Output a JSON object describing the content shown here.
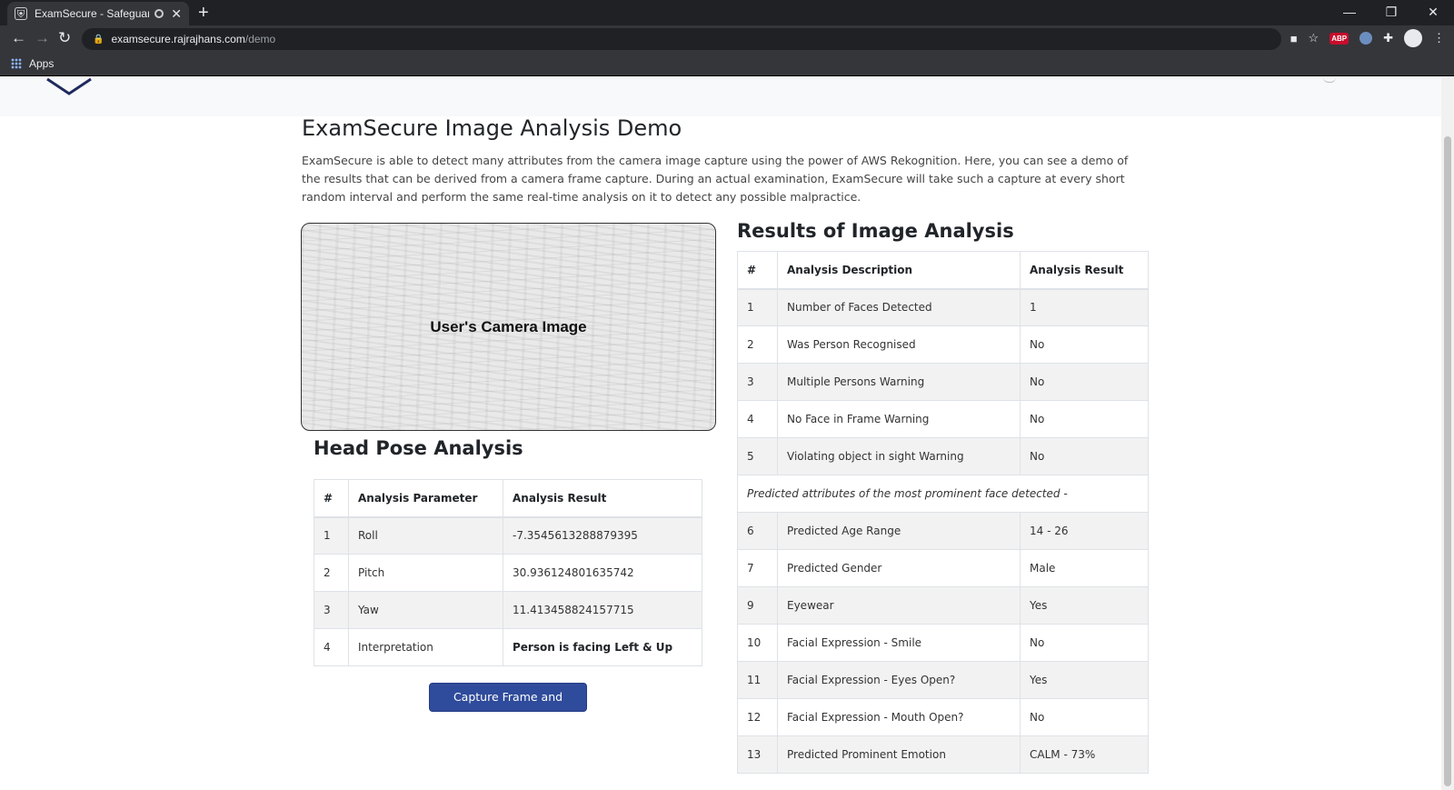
{
  "browser": {
    "tab_title": "ExamSecure - Safeguard you",
    "url_domain": "examsecure.rajrajhans.com",
    "url_path": "/demo",
    "bookmarks_apps": "Apps",
    "abp_label": "ABP",
    "window_controls": [
      "—",
      "❐",
      "✕"
    ]
  },
  "page": {
    "title": "ExamSecure Image Analysis Demo",
    "intro": "ExamSecure is able to detect many attributes from the camera image capture using the power of AWS Rekognition. Here, you can see a demo of the results that can be derived from a camera frame capture. During an actual examination, ExamSecure will take such a capture at every short random interval and perform the same real-time analysis on it to detect any possible malpractice.",
    "camera_label": "User's Camera Image",
    "capture_button": "Capture Frame and Analyze"
  },
  "head_pose": {
    "title": "Head Pose Analysis",
    "headers": [
      "#",
      "Analysis Parameter",
      "Analysis Result"
    ],
    "rows": [
      {
        "n": "1",
        "param": "Roll",
        "result": "-7.3545613288879395"
      },
      {
        "n": "2",
        "param": "Pitch",
        "result": "30.936124801635742"
      },
      {
        "n": "3",
        "param": "Yaw",
        "result": "11.413458824157715"
      },
      {
        "n": "4",
        "param": "Interpretation",
        "result": "Person is facing Left & Up"
      }
    ]
  },
  "results": {
    "title": "Results of Image Analysis",
    "headers": [
      "#",
      "Analysis Description",
      "Analysis Result"
    ],
    "rows": [
      {
        "n": "1",
        "desc": "Number of Faces Detected",
        "result": "1"
      },
      {
        "n": "2",
        "desc": "Was Person Recognised",
        "result": "No"
      },
      {
        "n": "3",
        "desc": "Multiple Persons Warning",
        "result": "No"
      },
      {
        "n": "4",
        "desc": "No Face in Frame Warning",
        "result": "No"
      },
      {
        "n": "5",
        "desc": "Violating object in sight Warning",
        "result": "No"
      }
    ],
    "face_note": "Predicted attributes of the most prominent face detected -",
    "face_rows": [
      {
        "n": "6",
        "desc": "Predicted Age Range",
        "result": "14 - 26"
      },
      {
        "n": "7",
        "desc": "Predicted Gender",
        "result": "Male"
      },
      {
        "n": "9",
        "desc": "Eyewear",
        "result": "Yes"
      },
      {
        "n": "10",
        "desc": "Facial Expression - Smile",
        "result": "No"
      },
      {
        "n": "11",
        "desc": "Facial Expression - Eyes Open?",
        "result": "Yes"
      },
      {
        "n": "12",
        "desc": "Facial Expression - Mouth Open?",
        "result": "No"
      },
      {
        "n": "13",
        "desc": "Predicted Prominent Emotion",
        "result": "CALM - 73%"
      }
    ]
  },
  "colors": {
    "primary_button": "#2f4b9b",
    "logo_stroke": "#1f2a5e"
  }
}
